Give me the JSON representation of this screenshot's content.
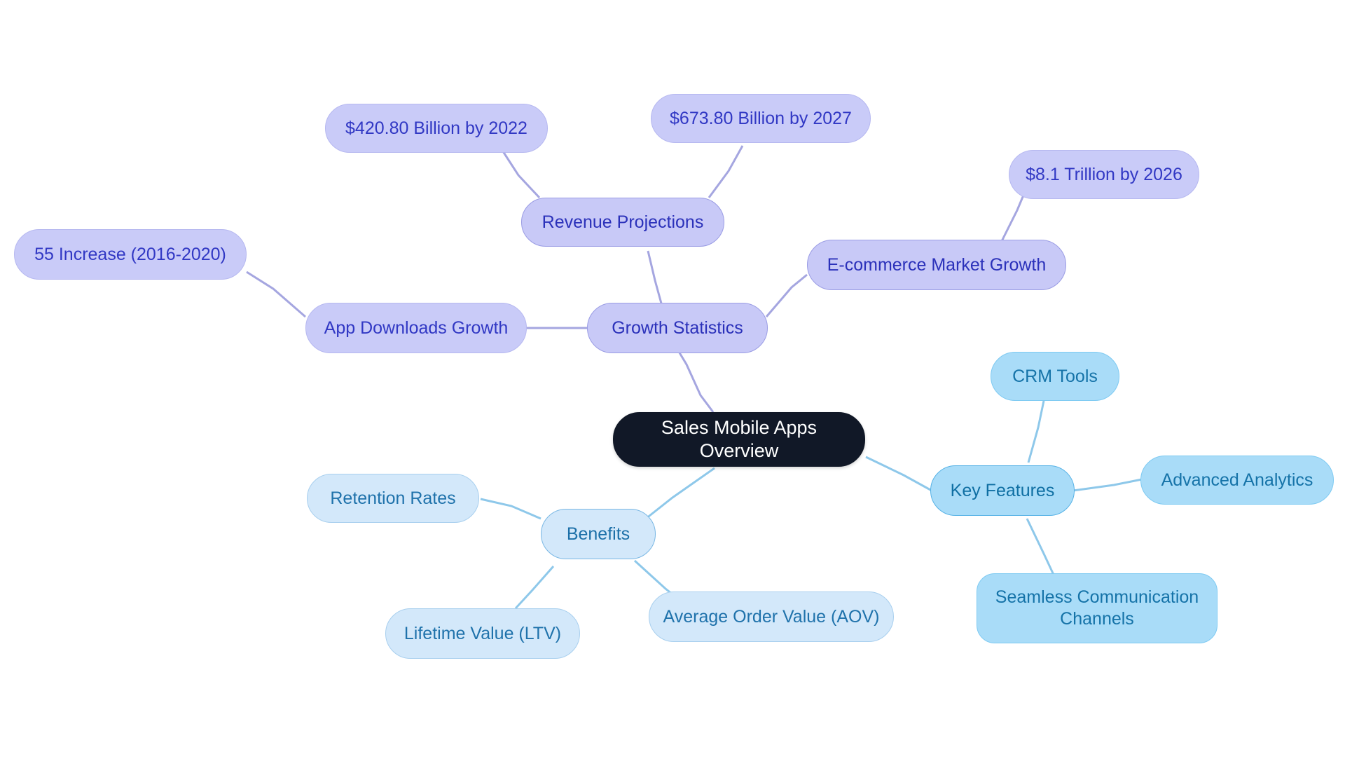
{
  "diagram": {
    "type": "mindmap",
    "title": "Sales Mobile Apps Overview",
    "background": "#ffffff",
    "palette": {
      "root_fill": "#111827",
      "root_text": "#ffffff",
      "purple_fill": "#c8c9f7",
      "purple_border": "#9a9ce4",
      "purple_text": "#2b31ba",
      "blue_fill": "#a9dcf8",
      "blue_border": "#56b2e6",
      "blue_text": "#0f6fa3",
      "benefit_fill": "#d3e8fa",
      "benefit_border": "#79b7e4",
      "benefit_text": "#1b6fa8",
      "edge_purple": "#a5a6e0",
      "edge_blue": "#8ec8ea"
    }
  },
  "root": {
    "label": "Sales Mobile Apps Overview"
  },
  "branches": [
    {
      "id": "growth-statistics",
      "label": "Growth Statistics",
      "color": "purple",
      "children": [
        {
          "id": "revenue-projections",
          "label": "Revenue Projections",
          "children": [
            {
              "id": "rev-2022",
              "label": "$420.80 Billion by 2022"
            },
            {
              "id": "rev-2027",
              "label": "$673.80 Billion by 2027"
            }
          ]
        },
        {
          "id": "app-downloads-growth",
          "label": "App Downloads Growth",
          "children": [
            {
              "id": "increase-2016-2020",
              "label": "55 Increase (2016-2020)"
            }
          ]
        },
        {
          "id": "ecommerce-market-growth",
          "label": "E-commerce Market Growth",
          "children": [
            {
              "id": "ecom-2026",
              "label": "$8.1 Trillion by 2026"
            }
          ]
        }
      ]
    },
    {
      "id": "key-features",
      "label": "Key Features",
      "color": "blue",
      "children": [
        {
          "id": "crm-tools",
          "label": "CRM Tools"
        },
        {
          "id": "advanced-analytics",
          "label": "Advanced Analytics"
        },
        {
          "id": "seamless-communication-channels",
          "label": "Seamless Communication\nChannels"
        }
      ]
    },
    {
      "id": "benefits",
      "label": "Benefits",
      "color": "benefit",
      "children": [
        {
          "id": "retention-rates",
          "label": "Retention Rates"
        },
        {
          "id": "lifetime-value",
          "label": "Lifetime Value (LTV)"
        },
        {
          "id": "average-order-value",
          "label": "Average Order Value (AOV)"
        }
      ]
    }
  ],
  "nodes": {
    "root": {
      "label": "Sales Mobile Apps Overview"
    },
    "growth_statistics": {
      "label": "Growth Statistics"
    },
    "revenue_projections": {
      "label": "Revenue Projections"
    },
    "rev_2022": {
      "label": "$420.80 Billion by 2022"
    },
    "rev_2027": {
      "label": "$673.80 Billion by 2027"
    },
    "app_downloads_growth": {
      "label": "App Downloads Growth"
    },
    "increase_2016_2020": {
      "label": "55 Increase (2016-2020)"
    },
    "ecommerce_market_growth": {
      "label": "E-commerce Market Growth"
    },
    "ecom_2026": {
      "label": "$8.1 Trillion by 2026"
    },
    "key_features": {
      "label": "Key Features"
    },
    "crm_tools": {
      "label": "CRM Tools"
    },
    "advanced_analytics": {
      "label": "Advanced Analytics"
    },
    "seamless_communication": {
      "label": "Seamless Communication\nChannels"
    },
    "benefits": {
      "label": "Benefits"
    },
    "retention_rates": {
      "label": "Retention Rates"
    },
    "lifetime_value": {
      "label": "Lifetime Value (LTV)"
    },
    "average_order_value": {
      "label": "Average Order Value (AOV)"
    }
  }
}
